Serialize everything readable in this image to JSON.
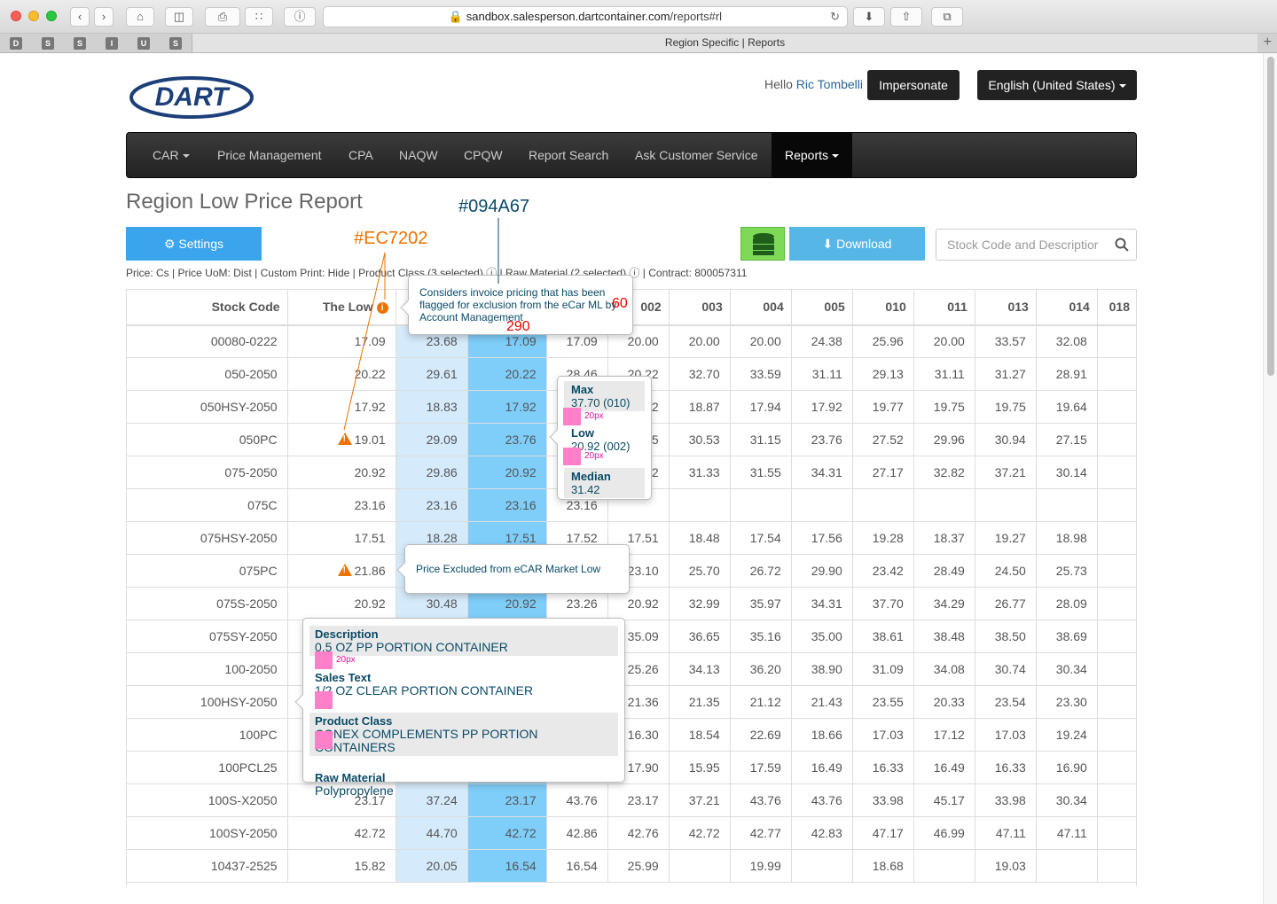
{
  "browser": {
    "url_host": "sandbox.salesperson.dartcontainer.com",
    "url_path": "/reports#rl",
    "tab_title": "Region Specific | Reports",
    "favorites": [
      "D",
      "S",
      "S",
      "I",
      "U",
      "S"
    ]
  },
  "header": {
    "logo_text": "DART",
    "greeting": "Hello",
    "user_name": "Ric Tombelli",
    "impersonate_label": "Impersonate",
    "language_label": "English (United States)"
  },
  "nav": {
    "items": [
      {
        "label": "CAR",
        "dropdown": true
      },
      {
        "label": "Price Management",
        "dropdown": false
      },
      {
        "label": "CPA",
        "dropdown": false
      },
      {
        "label": "NAQW",
        "dropdown": false
      },
      {
        "label": "CPQW",
        "dropdown": false
      },
      {
        "label": "Report Search",
        "dropdown": false
      },
      {
        "label": "Ask Customer Service",
        "dropdown": false
      },
      {
        "label": "Reports",
        "dropdown": true,
        "active": true
      }
    ]
  },
  "page": {
    "title": "Region Low Price Report",
    "settings_label": "Settings",
    "download_label": "Download",
    "search_placeholder": "Stock Code and Descriptior",
    "filters": {
      "price": "Price: Cs",
      "uom": "Price UoM: Dist",
      "custom_print": "Custom Print: Hide",
      "product_class": "Product Class (3 selected)",
      "raw_material": "Raw Material (2 selected)",
      "contract": "Contract: 800057311"
    }
  },
  "table": {
    "headers": [
      "Stock Code",
      "The Low",
      "",
      "",
      "",
      "002",
      "003",
      "004",
      "005",
      "010",
      "011",
      "013",
      "014",
      "018"
    ],
    "rows": [
      {
        "code": "00080-0222",
        "warn": false,
        "v": [
          "17.09",
          "23.68",
          "17.09",
          "17.09",
          "20.00",
          "20.00",
          "20.00",
          "24.38",
          "25.96",
          "20.00",
          "33.57",
          "32.08",
          ""
        ]
      },
      {
        "code": "050-2050",
        "warn": false,
        "v": [
          "20.22",
          "29.61",
          "20.22",
          "28.46",
          "20.22",
          "32.70",
          "33.59",
          "31.11",
          "29.13",
          "31.11",
          "31.27",
          "28.91",
          ""
        ]
      },
      {
        "code": "050HSY-2050",
        "warn": false,
        "v": [
          "17.92",
          "18.83",
          "17.92",
          "",
          "19.02",
          "18.87",
          "17.94",
          "17.92",
          "19.77",
          "19.75",
          "19.75",
          "19.64",
          ""
        ]
      },
      {
        "code": "050PC",
        "warn": true,
        "v": [
          "19.01",
          "29.09",
          "23.76",
          "",
          "20.15",
          "30.53",
          "31.15",
          "23.76",
          "27.52",
          "29.96",
          "30.94",
          "27.15",
          ""
        ]
      },
      {
        "code": "075-2050",
        "warn": false,
        "v": [
          "20.92",
          "29.86",
          "20.92",
          "",
          "20.92",
          "31.33",
          "31.55",
          "34.31",
          "27.17",
          "32.82",
          "37.21",
          "30.14",
          ""
        ]
      },
      {
        "code": "075C",
        "warn": false,
        "v": [
          "23.16",
          "23.16",
          "23.16",
          "23.16",
          "",
          "",
          "",
          "",
          "",
          "",
          "",
          "",
          ""
        ]
      },
      {
        "code": "075HSY-2050",
        "warn": false,
        "v": [
          "17.51",
          "18.28",
          "17.51",
          "17.52",
          "17.51",
          "18.48",
          "17.54",
          "17.56",
          "19.28",
          "18.37",
          "19.27",
          "18.98",
          ""
        ]
      },
      {
        "code": "075PC",
        "warn": true,
        "v": [
          "21.86",
          "",
          "",
          "",
          "23.10",
          "25.70",
          "26.72",
          "29.90",
          "23.42",
          "28.49",
          "24.50",
          "25.73",
          ""
        ]
      },
      {
        "code": "075S-2050",
        "warn": false,
        "v": [
          "20.92",
          "30.48",
          "20.92",
          "23.26",
          "20.92",
          "32.99",
          "35.97",
          "34.31",
          "37.70",
          "34.29",
          "26.77",
          "28.09",
          ""
        ]
      },
      {
        "code": "075SY-2050",
        "warn": false,
        "v": [
          "",
          "",
          "",
          "",
          "35.09",
          "36.65",
          "35.16",
          "35.00",
          "38.61",
          "38.48",
          "38.50",
          "38.69",
          ""
        ]
      },
      {
        "code": "100-2050",
        "warn": false,
        "v": [
          "",
          "",
          "",
          "",
          "25.26",
          "34.13",
          "36.20",
          "38.90",
          "31.09",
          "34.08",
          "30.74",
          "30.34",
          ""
        ]
      },
      {
        "code": "100HSY-2050",
        "warn": false,
        "v": [
          "",
          "",
          "",
          "",
          "21.36",
          "21.35",
          "21.12",
          "21.43",
          "23.55",
          "20.33",
          "23.54",
          "23.30",
          ""
        ]
      },
      {
        "code": "100PC",
        "warn": false,
        "v": [
          "",
          "",
          "",
          "",
          "16.30",
          "18.54",
          "22.69",
          "18.66",
          "17.03",
          "17.12",
          "17.03",
          "19.24",
          ""
        ]
      },
      {
        "code": "100PCL25",
        "warn": false,
        "v": [
          "",
          "",
          "",
          "",
          "17.90",
          "15.95",
          "17.59",
          "16.49",
          "16.33",
          "16.49",
          "16.33",
          "16.90",
          ""
        ]
      },
      {
        "code": "100S-X2050",
        "warn": false,
        "v": [
          "23.17",
          "37.24",
          "23.17",
          "43.76",
          "23.17",
          "37.21",
          "43.76",
          "43.76",
          "33.98",
          "45.17",
          "33.98",
          "30.34",
          ""
        ]
      },
      {
        "code": "100SY-2050",
        "warn": false,
        "v": [
          "42.72",
          "44.70",
          "42.72",
          "42.86",
          "42.76",
          "42.72",
          "42.77",
          "42.83",
          "47.17",
          "46.99",
          "47.11",
          "47.11",
          ""
        ]
      },
      {
        "code": "10437-2525",
        "warn": false,
        "v": [
          "15.82",
          "20.05",
          "16.54",
          "16.54",
          "25.99",
          "",
          "19.99",
          "",
          "18.68",
          "",
          "19.03",
          "",
          ""
        ]
      }
    ]
  },
  "popovers": {
    "low_info": "Considers invoice pricing that has been flagged for exclusion from the eCar ML by Account Management",
    "excluded": "Price Excluded from eCAR Market Low",
    "stats": [
      {
        "label": "Max",
        "value": "37.70 (010)"
      },
      {
        "label": "Low",
        "value": "20.92 (002)"
      },
      {
        "label": "Median",
        "value": "31.42"
      }
    ],
    "details": [
      {
        "label": "Description",
        "value": "0.5 OZ PP PORTION CONTAINER"
      },
      {
        "label": "Sales Text",
        "value": "1/2 OZ CLEAR PORTION CONTAINER"
      },
      {
        "label": "Product Class",
        "value": "CONEX COMPLEMENTS PP PORTION CONTAINERS"
      },
      {
        "label": "Raw Material",
        "value": "Polypropylene"
      }
    ]
  },
  "annotations": {
    "orange": "#EC7202",
    "blue": "#094A67",
    "w": "60",
    "h": "290",
    "spacing": "20px"
  },
  "colors": {
    "accent_blue": "#3aa4ed",
    "warning_orange": "#ec7202",
    "text_dark_blue": "#094a67"
  }
}
